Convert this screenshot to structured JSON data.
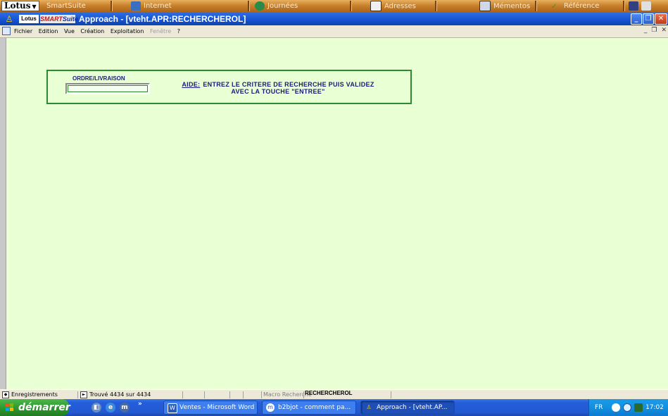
{
  "smartsuite_bar": {
    "lotus_menu": "Lotus",
    "drawers": [
      "SmartSuite",
      "Internet",
      "Journées",
      "Adresses",
      "Mémentos",
      "Référence"
    ]
  },
  "titlebar": {
    "logo_lotus": "Lotus",
    "logo_smart": "SMART",
    "logo_suite": "Suite",
    "title": "Approach - [vteht.APR:RECHERCHEROL]"
  },
  "menu": {
    "items": [
      "Fichier",
      "Edition",
      "Vue",
      "Création",
      "Exploitation",
      "Fenêtre",
      "?"
    ]
  },
  "form": {
    "field_label": "ORDRE/LIVRAISON",
    "field_value": "",
    "help_prefix": "AIDE:",
    "help_line1": "ENTREZ LE CRITERE DE RECHERCHE PUIS VALIDEZ",
    "help_line2": "AVEC LA TOUCHE \"ENTREE\""
  },
  "statusbar": {
    "records": "Enregistrements",
    "found": "Trouvé 4434 sur 4434",
    "macro_label": "Macro Recherche",
    "macro_value": "RECHERCHEROL"
  },
  "taskbar": {
    "start": "démarrer",
    "tasks": [
      "Ventes - Microsoft Word",
      "b2bjot - comment pa...",
      "Approach - [vteht.AP..."
    ],
    "lang": "FR",
    "clock": "17:02"
  }
}
